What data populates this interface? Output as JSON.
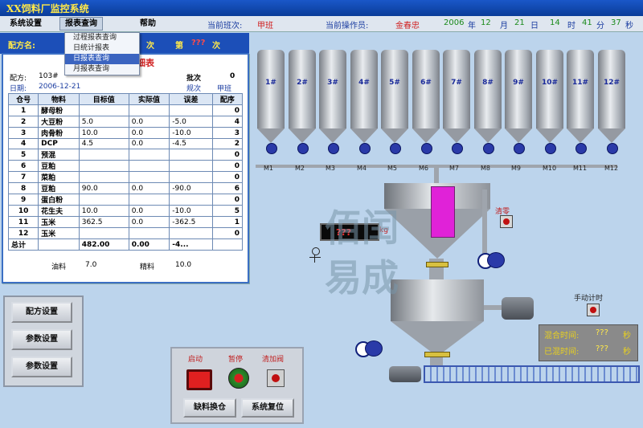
{
  "title": "XX饲料厂监控系统",
  "menu": {
    "items": [
      "系统设置",
      "报表查询",
      "帮助"
    ],
    "shift_label": "当前班次:",
    "shift_value": "甲班",
    "operator_label": "当前操作员:",
    "operator_value": "金春忠",
    "year": "2006",
    "year_unit": "年",
    "month": "12",
    "month_unit": "月",
    "day": "21",
    "day_unit": "日",
    "hour": "14",
    "hour_unit": "时",
    "minute": "41",
    "minute_unit": "分",
    "second": "37",
    "second_unit": "秒"
  },
  "dropdown": {
    "items": [
      "过程报表查询",
      "日统计报表",
      "日报表查询",
      "月报表查询"
    ],
    "selected_index": 2
  },
  "recipe_bar": {
    "recipe_name_label": "配方名:",
    "batch_count_suffix": "次",
    "batch_no_label": "第",
    "batch_no_value": "???",
    "batch_no_suffix": "次"
  },
  "recipe_panel": {
    "title": "细表",
    "recipe_label": "配方:",
    "recipe_value": "103#",
    "batch_label": "批次",
    "batch_value": "0",
    "date_label": "日期:",
    "date_value": "2006-12-21",
    "rule_label": "规次",
    "shift_label": "甲班",
    "columns": [
      "仓号",
      "物料",
      "目标值",
      "实际值",
      "误差",
      "配序"
    ],
    "rows": [
      [
        "1",
        "酵母粉",
        "",
        "",
        "",
        "0"
      ],
      [
        "2",
        "大豆粉",
        "5.0",
        "0.0",
        "-5.0",
        "4"
      ],
      [
        "3",
        "肉骨粉",
        "10.0",
        "0.0",
        "-10.0",
        "3"
      ],
      [
        "4",
        "DCP",
        "4.5",
        "0.0",
        "-4.5",
        "2"
      ],
      [
        "5",
        "预混",
        "",
        "",
        "",
        "0"
      ],
      [
        "6",
        "豆粕",
        "",
        "",
        "",
        "0"
      ],
      [
        "7",
        "菜粕",
        "",
        "",
        "",
        "0"
      ],
      [
        "8",
        "豆粕",
        "90.0",
        "0.0",
        "-90.0",
        "6"
      ],
      [
        "9",
        "蛋白粉",
        "",
        "",
        "",
        "0"
      ],
      [
        "10",
        "花生夫",
        "10.0",
        "0.0",
        "-10.0",
        "5"
      ],
      [
        "11",
        "玉米",
        "362.5",
        "0.0",
        "-362.5",
        "1"
      ],
      [
        "12",
        "玉米",
        "",
        "",
        "",
        "0"
      ]
    ],
    "total_label": "总计",
    "total_target": "482.00",
    "total_actual": "0.00",
    "total_error": "-4...",
    "oil_label": "油料",
    "oil_value": "7.0",
    "fine_label": "精料",
    "fine_value": "10.0"
  },
  "left_buttons": [
    "配方设置",
    "参数设置",
    "参数设置"
  ],
  "control": {
    "start_label": "启动",
    "pause_label": "暂停",
    "feed_label": "清加阀",
    "swap_button": "缺料换仓",
    "reset_button": "系统复位"
  },
  "silos": [
    "1#",
    "2#",
    "3#",
    "4#",
    "5#",
    "6#",
    "7#",
    "8#",
    "9#",
    "10#",
    "11#",
    "12#"
  ],
  "motors": [
    "M1",
    "M2",
    "M3",
    "M4",
    "M5",
    "M6",
    "M7",
    "M8",
    "M9",
    "M10",
    "M11",
    "M12"
  ],
  "scale_display": "???",
  "scale_unit": "kg",
  "clear_label": "清零",
  "manual_timer_label": "手动计时",
  "times": {
    "mix_label": "混合时间:",
    "mix_value": "???",
    "mix_unit": "秒",
    "elapsed_label": "已混时间:",
    "elapsed_value": "???",
    "elapsed_unit": "秒"
  },
  "watermark": [
    "佰闰",
    "易成"
  ],
  "colors": {
    "title_bg": "#0a3c98",
    "title_text": "#ffe94a",
    "panel_bg": "#bcd4ec",
    "alert_red": "#d02020",
    "mix_bar": "#e022d8"
  }
}
